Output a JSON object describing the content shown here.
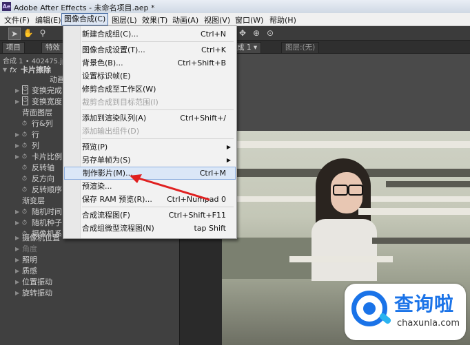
{
  "window": {
    "app_icon": "Ae",
    "title": "Adobe After Effects - 未命名项目.aep *"
  },
  "menubar": [
    "文件(F)",
    "编辑(E)",
    "图像合成(C)",
    "图层(L)",
    "效果(T)",
    "动画(A)",
    "视图(V)",
    "窗口(W)",
    "帮助(H)"
  ],
  "toolbar": {
    "icons": [
      "selection-icon",
      "hand-icon",
      "zoom-icon"
    ]
  },
  "panels": {
    "left_tabs": [
      "项目",
      "特效"
    ],
    "comp_tab": "成 1 ▾",
    "layer_tab": "图层:(无)"
  },
  "effect_controls": {
    "header": "合成 1 • 402475.jp",
    "effect_name": "卡片擦除",
    "anim_label": "动画",
    "rows": [
      {
        "label": "变换完成",
        "tri": true,
        "sw": true
      },
      {
        "label": "变换宽度",
        "tri": true,
        "sw": true
      },
      {
        "label": "背面图层",
        "tri": false,
        "sw": false
      },
      {
        "label": "行&列",
        "tri": false,
        "sw": true
      },
      {
        "label": "行",
        "tri": true,
        "sw": true
      },
      {
        "label": "列",
        "tri": true,
        "sw": true
      },
      {
        "label": "卡片比例",
        "tri": true,
        "sw": true
      },
      {
        "label": "反转轴",
        "tri": false,
        "sw": true
      },
      {
        "label": "反方向",
        "tri": false,
        "sw": true
      },
      {
        "label": "反转顺序",
        "tri": false,
        "sw": true
      },
      {
        "label": "渐变层",
        "tri": false,
        "sw": false
      },
      {
        "label": "随机时间",
        "tri": true,
        "sw": true
      },
      {
        "label": "随机种子",
        "tri": true,
        "sw": true
      },
      {
        "label": "摄像机系",
        "tri": false,
        "sw": true
      }
    ],
    "groups": [
      "摄像机位置",
      "角度",
      "照明",
      "质感",
      "位置振动",
      "旋转振动"
    ],
    "dim_group": "角度"
  },
  "menu": {
    "items": [
      {
        "label": "新建合成组(C)...",
        "shortcut": "Ctrl+N",
        "state": "normal"
      },
      {
        "sep": true
      },
      {
        "label": "图像合成设置(T)...",
        "shortcut": "Ctrl+K",
        "state": "normal"
      },
      {
        "label": "背景色(B)...",
        "shortcut": "Ctrl+Shift+B",
        "state": "normal"
      },
      {
        "label": "设置标识帧(E)",
        "shortcut": "",
        "state": "normal"
      },
      {
        "label": "修剪合成至工作区(W)",
        "shortcut": "",
        "state": "normal"
      },
      {
        "label": "裁剪合成到目标范围(I)",
        "shortcut": "",
        "state": "disabled"
      },
      {
        "sep": true
      },
      {
        "label": "添加到渲染队列(A)",
        "shortcut": "Ctrl+Shift+/",
        "state": "normal"
      },
      {
        "label": "添加输出组件(D)",
        "shortcut": "",
        "state": "disabled"
      },
      {
        "sep": true
      },
      {
        "label": "预览(P)",
        "shortcut": "",
        "state": "submenu"
      },
      {
        "label": "另存单帧为(S)",
        "shortcut": "",
        "state": "submenu"
      },
      {
        "label": "制作影片(M)...",
        "shortcut": "Ctrl+M",
        "state": "highlight"
      },
      {
        "label": "预渲染...",
        "shortcut": "",
        "state": "normal"
      },
      {
        "label": "保存 RAM 预览(R)...",
        "shortcut": "Ctrl+Numpad 0",
        "state": "normal"
      },
      {
        "sep": true
      },
      {
        "label": "合成流程图(F)",
        "shortcut": "Ctrl+Shift+F11",
        "state": "normal"
      },
      {
        "label": "合成组微型流程图(N)",
        "shortcut": "tap Shift",
        "state": "normal"
      }
    ]
  },
  "watermark": {
    "brand": "查询啦",
    "url": "chaxunla.com"
  },
  "colors": {
    "accent": "#1a73e8",
    "arrow": "#e02020",
    "menu_highlight": "#dbe7f7"
  }
}
